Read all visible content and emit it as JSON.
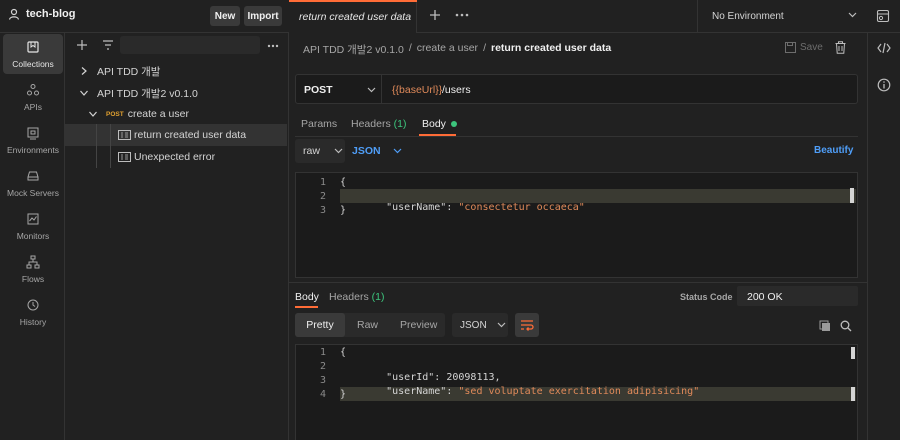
{
  "workspace": {
    "name": "tech-blog",
    "new_label": "New",
    "import_label": "Import"
  },
  "request_tab": {
    "title": "return created user data"
  },
  "environment": {
    "selected": "No Environment"
  },
  "rail": [
    {
      "label": "Collections",
      "icon": "collections-icon"
    },
    {
      "label": "APIs",
      "icon": "apis-icon"
    },
    {
      "label": "Environments",
      "icon": "environments-icon"
    },
    {
      "label": "Mock Servers",
      "icon": "mock-servers-icon"
    },
    {
      "label": "Monitors",
      "icon": "monitors-icon"
    },
    {
      "label": "Flows",
      "icon": "flows-icon"
    },
    {
      "label": "History",
      "icon": "history-icon"
    }
  ],
  "tree": {
    "col1": "API TDD 개발",
    "col2": "API TDD 개발2 v0.1.0",
    "folder_method": "POST",
    "folder": "create a user",
    "ex1": "return created user data",
    "ex2": "Unexpected error"
  },
  "breadcrumb": {
    "part1": "API TDD 개발2 v0.1.0",
    "sep1": "/",
    "part2": "create a user",
    "sep2": "/",
    "current": "return created user data",
    "save_label": "Save"
  },
  "request": {
    "method": "POST",
    "url_var": "{{baseUrl}}",
    "url_path": "/users",
    "tabs": {
      "params": "Params",
      "headers": "Headers",
      "headers_count": "(1)",
      "body": "Body"
    },
    "body_mode": "raw",
    "body_lang": "JSON",
    "beautify_label": "Beautify",
    "lines": [
      "1",
      "2",
      "3"
    ],
    "code": {
      "l1": "{",
      "l2_key": "\"userName\"",
      "l2_colon": ": ",
      "l2_val": "\"consectetur occaeca\"",
      "l3": "}"
    }
  },
  "response": {
    "tabs": {
      "body": "Body",
      "headers": "Headers",
      "headers_count": "(1)"
    },
    "status_label": "Status Code",
    "status_value": "200 OK",
    "views": {
      "pretty": "Pretty",
      "raw": "Raw",
      "preview": "Preview"
    },
    "lang": "JSON",
    "lines": [
      "1",
      "2",
      "3",
      "4"
    ],
    "code": {
      "l1": "{",
      "l2_key": "\"userId\"",
      "l2_colon": ": ",
      "l2_val": "20098113",
      "l2_comma": ",",
      "l3_key": "\"userName\"",
      "l3_colon": ": ",
      "l3_val": "\"sed voluptate exercitation adipisicing\"",
      "l4": "}"
    }
  },
  "colors": {
    "accent": "#ff6c37",
    "link_blue": "#4f9ef8",
    "url_var": "#e08a5a",
    "active_dot": "#3cc47c"
  }
}
